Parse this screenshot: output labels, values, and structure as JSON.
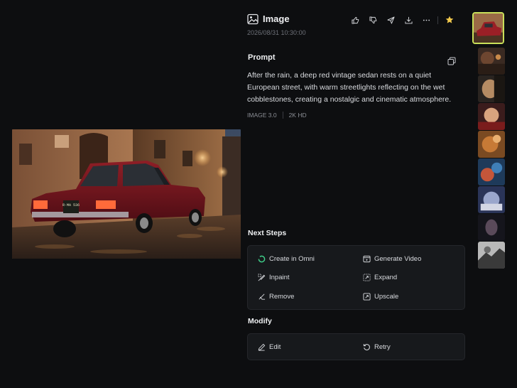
{
  "header": {
    "title": "Image",
    "date": "2026/08/31 10:30:00",
    "actions": [
      "thumbs-up-icon",
      "thumbs-down-icon",
      "share-icon",
      "download-icon",
      "more-icon",
      "star-icon"
    ],
    "star_color": "#f2c94c"
  },
  "prompt": {
    "label": "Prompt",
    "text": "After the rain, a deep red vintage sedan rests on a quiet European street, with warm streetlights reflecting on the wet cobblestones, creating a nostalgic and cinematic atmosphere.",
    "model": "IMAGE 3.0",
    "resolution": "2K HD"
  },
  "next_steps": {
    "label": "Next Steps",
    "items": [
      {
        "label": "Create in Omni",
        "icon": "omni-icon"
      },
      {
        "label": "Generate Video",
        "icon": "video-icon"
      },
      {
        "label": "Inpaint",
        "icon": "inpaint-icon"
      },
      {
        "label": "Expand",
        "icon": "expand-icon"
      },
      {
        "label": "Remove",
        "icon": "remove-icon"
      },
      {
        "label": "Upscale",
        "icon": "upscale-icon"
      }
    ]
  },
  "modify": {
    "label": "Modify",
    "items": [
      {
        "label": "Edit",
        "icon": "edit-icon"
      },
      {
        "label": "Retry",
        "icon": "retry-icon"
      }
    ]
  },
  "thumbnails": {
    "count": 9,
    "active_index": 0,
    "accent": "#c9e05a"
  },
  "main_image": {
    "plate": "R·MA 536"
  }
}
